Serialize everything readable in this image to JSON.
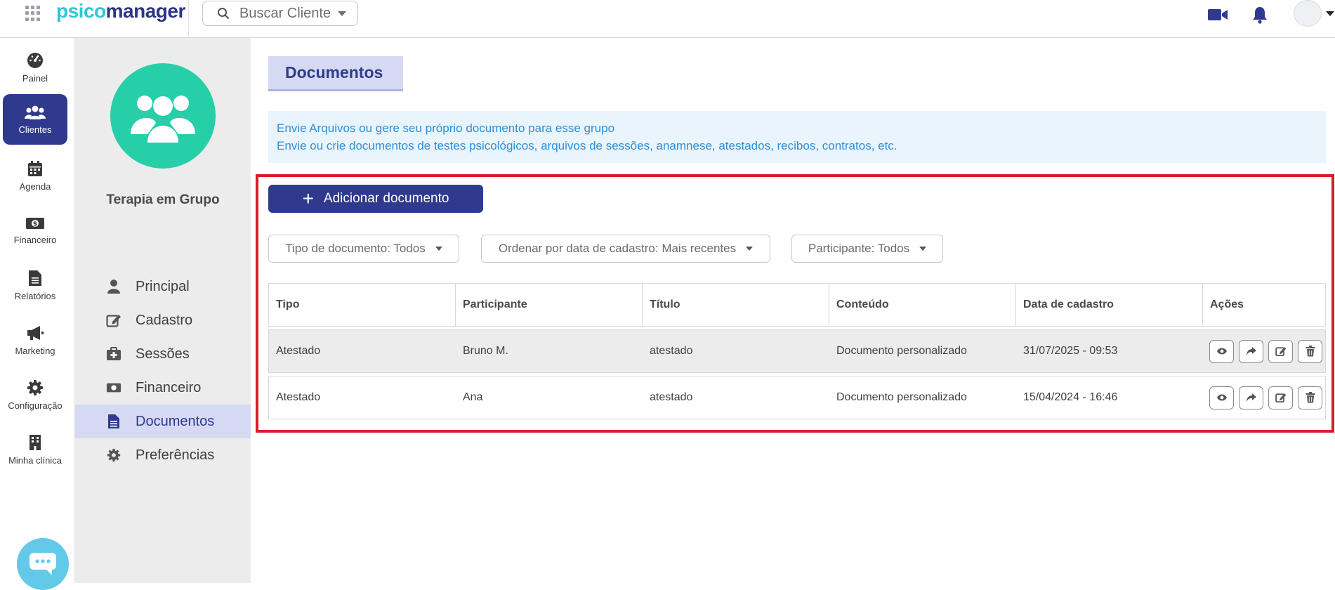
{
  "header": {
    "logo_part1": "psico",
    "logo_part2": "manager",
    "search_placeholder": "Buscar Cliente"
  },
  "rail": {
    "items": [
      {
        "label": "Painel",
        "icon": "dashboard-icon"
      },
      {
        "label": "Clientes",
        "icon": "users-icon",
        "active": true
      },
      {
        "label": "Agenda",
        "icon": "calendar-icon"
      },
      {
        "label": "Financeiro",
        "icon": "money-icon"
      },
      {
        "label": "Relatórios",
        "icon": "report-icon"
      },
      {
        "label": "Marketing",
        "icon": "megaphone-icon"
      },
      {
        "label": "Configuração",
        "icon": "gear-icon"
      },
      {
        "label": "Minha clínica",
        "icon": "building-icon"
      }
    ]
  },
  "client": {
    "name": "Terapia em Grupo"
  },
  "subnav": {
    "items": [
      {
        "label": "Principal",
        "icon": "user-icon"
      },
      {
        "label": "Cadastro",
        "icon": "edit-icon"
      },
      {
        "label": "Sessões",
        "icon": "medkit-icon"
      },
      {
        "label": "Financeiro",
        "icon": "money-icon"
      },
      {
        "label": "Documentos",
        "icon": "document-icon",
        "active": true
      },
      {
        "label": "Preferências",
        "icon": "gear-icon"
      }
    ]
  },
  "main": {
    "title": "Documentos",
    "info_line1": "Envie Arquivos ou gere seu próprio documento para esse grupo",
    "info_line2": "Envie ou crie documentos de testes psicológicos, arquivos de sessões, anamnese, atestados, recibos, contratos, etc.",
    "add_button": "Adicionar documento",
    "filters": {
      "type": "Tipo de documento: Todos",
      "order": "Ordenar por data de cadastro: Mais recentes",
      "participant": "Participante: Todos"
    },
    "table": {
      "headers": [
        "Tipo",
        "Participante",
        "Título",
        "Conteúdo",
        "Data de cadastro",
        "Ações"
      ],
      "rows": [
        [
          "Atestado",
          "Bruno M.",
          "atestado",
          "Documento personalizado",
          "31/07/2025 - 09:53"
        ],
        [
          "Atestado",
          "Ana",
          "atestado",
          "Documento personalizado",
          "15/04/2024 - 16:46"
        ]
      ]
    }
  },
  "colors": {
    "primary": "#2f3a8f",
    "accent_teal": "#26cfa8",
    "info_text": "#2d8fd8",
    "highlight_border": "#dc1c2c"
  }
}
